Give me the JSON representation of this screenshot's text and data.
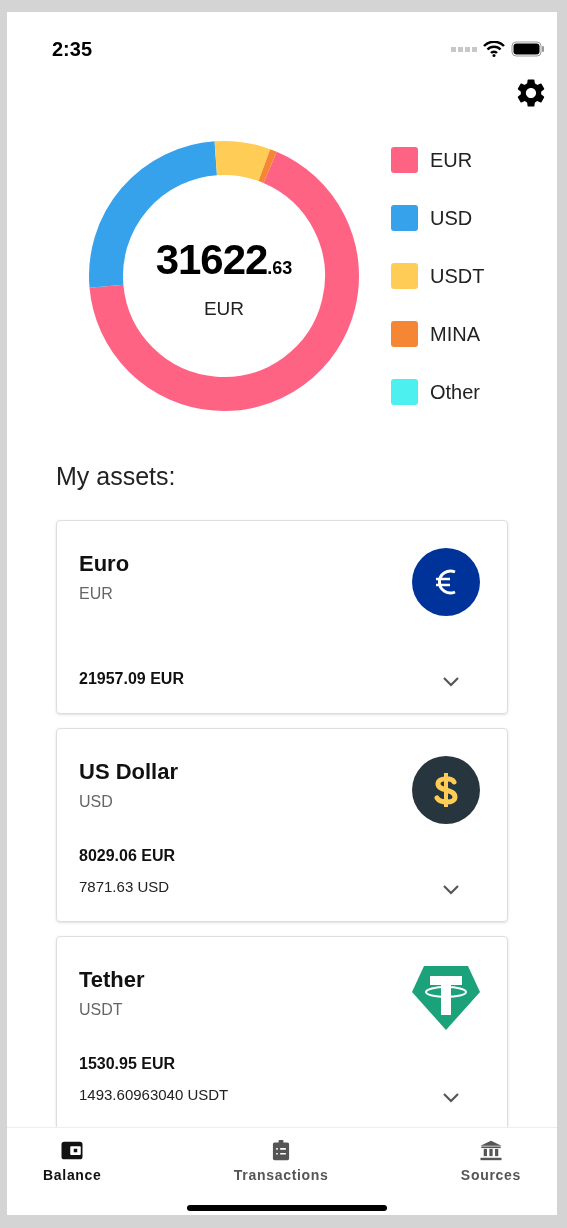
{
  "status_bar": {
    "time": "2:35"
  },
  "balance": {
    "integer": "31622",
    "fraction": ".63",
    "currency": "EUR"
  },
  "legend": [
    {
      "label": "EUR",
      "color": "#ff6384"
    },
    {
      "label": "USD",
      "color": "#36a2eb"
    },
    {
      "label": "USDT",
      "color": "#ffcd56"
    },
    {
      "label": "MINA",
      "color": "#f58634"
    },
    {
      "label": "Other",
      "color": "#4bf0ef"
    }
  ],
  "assets_title": "My assets:",
  "assets": [
    {
      "name": "Euro",
      "code": "EUR",
      "value": "21957.09 EUR"
    },
    {
      "name": "US Dollar",
      "code": "USD",
      "value": "8029.06 EUR",
      "amount": "7871.63 USD"
    },
    {
      "name": "Tether",
      "code": "USDT",
      "value": "1530.95 EUR",
      "amount": "1493.60963040 USDT"
    }
  ],
  "tabs": [
    {
      "label": "Balance",
      "selected": true
    },
    {
      "label": "Transactions",
      "selected": false
    },
    {
      "label": "Sources",
      "selected": false
    }
  ]
}
